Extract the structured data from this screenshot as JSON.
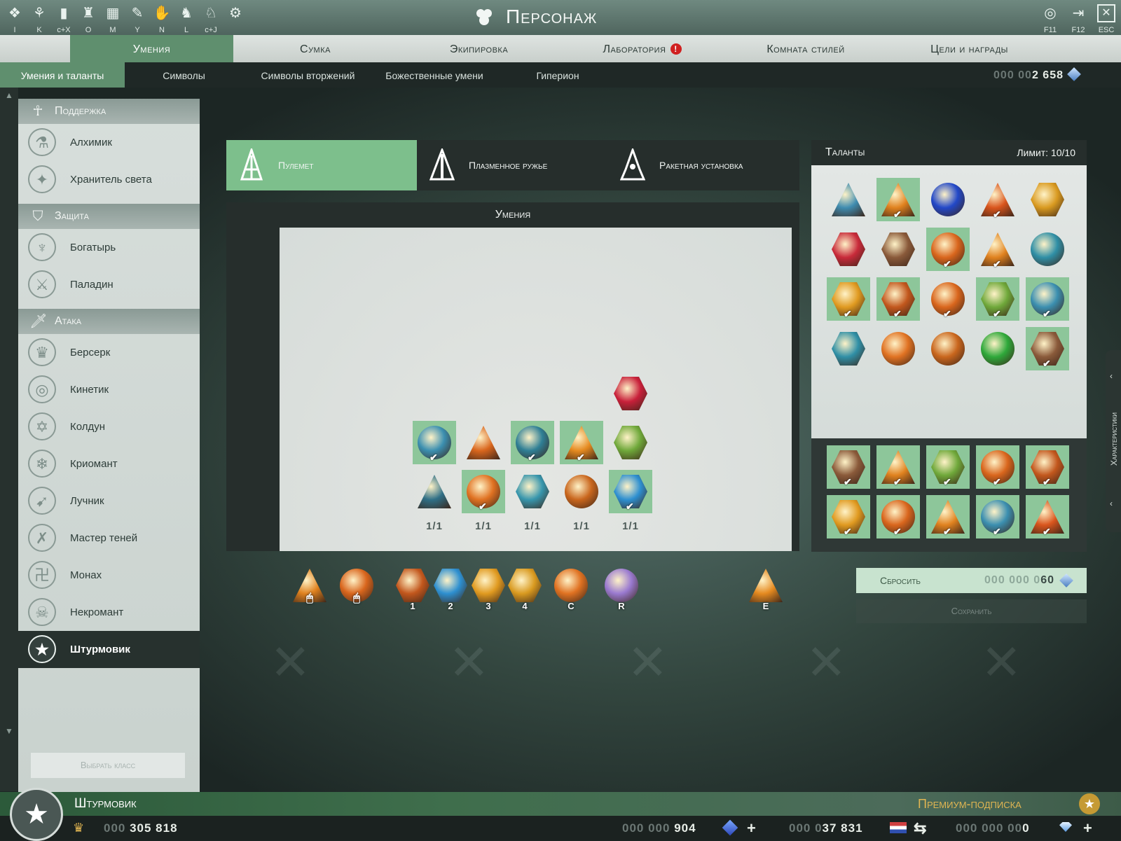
{
  "window": {
    "title": "Персонаж",
    "hotkeys_left": [
      "I",
      "K",
      "c+X",
      "O",
      "M",
      "Y",
      "N",
      "L",
      "c+J"
    ],
    "icons_left": [
      "character-icon",
      "skills-icon",
      "stats-icon",
      "guild-icon",
      "map-icon",
      "chat-icon",
      "friends-icon",
      "league-icon",
      "mount-icon",
      "settings-icon"
    ],
    "hotkeys_right": [
      "F11",
      "F12",
      "ESC"
    ]
  },
  "main_tabs": [
    {
      "label": "Умения",
      "active": true
    },
    {
      "label": "Сумка",
      "active": false
    },
    {
      "label": "Экипировка",
      "active": false
    },
    {
      "label": "Лаборатория",
      "active": false,
      "alert": "!"
    },
    {
      "label": "Комната стилей",
      "active": false
    },
    {
      "label": "Цели и награды",
      "active": false
    }
  ],
  "sub_tabs": [
    {
      "label": "Умения и таланты",
      "active": true
    },
    {
      "label": "Символы",
      "active": false
    },
    {
      "label": "Символы вторжений",
      "active": false
    },
    {
      "label": "Божественные умени",
      "active": false
    },
    {
      "label": "Гиперион",
      "active": false
    }
  ],
  "crystals": {
    "dim": "000 00",
    "value": "2 658"
  },
  "sidebar": {
    "categories": [
      {
        "label": "Поддержка",
        "icon": "ankh-icon",
        "classes": [
          {
            "label": "Алхимик",
            "icon": "flask-icon"
          },
          {
            "label": "Хранитель света",
            "icon": "wings-icon"
          }
        ]
      },
      {
        "label": "Защита",
        "icon": "shield-icon",
        "classes": [
          {
            "label": "Богатырь",
            "icon": "eagle-icon"
          },
          {
            "label": "Паладин",
            "icon": "sword-icon"
          }
        ]
      },
      {
        "label": "Атака",
        "icon": "dagger-icon",
        "classes": [
          {
            "label": "Берсерк",
            "icon": "helmet-icon"
          },
          {
            "label": "Кинетик",
            "icon": "spiral-icon"
          },
          {
            "label": "Колдун",
            "icon": "pentagram-icon"
          },
          {
            "label": "Криомант",
            "icon": "snowflake-icon"
          },
          {
            "label": "Лучник",
            "icon": "bow-icon"
          },
          {
            "label": "Мастер теней",
            "icon": "blades-icon"
          },
          {
            "label": "Монах",
            "icon": "glyph-icon"
          },
          {
            "label": "Некромант",
            "icon": "skull-icon"
          },
          {
            "label": "Штурмовик",
            "icon": "star-icon",
            "active": true
          }
        ]
      }
    ],
    "choose_class": "Выбрать класс"
  },
  "weapons": [
    {
      "label": "Пулемет",
      "active": true
    },
    {
      "label": "Плазменное ружье",
      "active": false
    },
    {
      "label": "Ракетная установка",
      "active": false
    }
  ],
  "skills": {
    "title": "Умения",
    "top": [
      {
        "color": "#c8203a",
        "shape": "hex"
      }
    ],
    "row1": [
      {
        "color": "#3b8fb0",
        "shape": "circle",
        "selected": true,
        "checked": true
      },
      {
        "color": "#d9661d",
        "shape": "tri",
        "selected": false,
        "checked": false
      },
      {
        "color": "#2f7f95",
        "shape": "circle",
        "selected": true,
        "checked": true
      },
      {
        "color": "#e58a20",
        "shape": "tri",
        "selected": true,
        "checked": true
      },
      {
        "color": "#6fa83a",
        "shape": "hex",
        "selected": false,
        "checked": false
      }
    ],
    "row2": [
      {
        "color": "#2f6f86",
        "shape": "tri",
        "selected": false,
        "checked": false
      },
      {
        "color": "#e07222",
        "shape": "circle",
        "selected": true,
        "checked": true
      },
      {
        "color": "#3796ad",
        "shape": "hex",
        "selected": false,
        "checked": false
      },
      {
        "color": "#c9661d",
        "shape": "circle",
        "selected": false,
        "checked": false
      },
      {
        "color": "#2d8fd0",
        "shape": "hex",
        "selected": true,
        "checked": true
      }
    ],
    "levels": [
      "1/1",
      "1/1",
      "1/1",
      "1/1",
      "1/1"
    ]
  },
  "talents": {
    "title": "Таланты",
    "limit": "Лимит: 10/10",
    "grid": [
      {
        "color": "#3f8cb0",
        "shape": "tri",
        "selected": false,
        "checked": false
      },
      {
        "color": "#e0821f",
        "shape": "tri",
        "selected": true,
        "checked": true
      },
      {
        "color": "#2248c8",
        "shape": "circle",
        "selected": false,
        "checked": false
      },
      {
        "color": "#d9551d",
        "shape": "tri",
        "selected": false,
        "checked": true
      },
      {
        "color": "#d99a20",
        "shape": "hex",
        "selected": false,
        "checked": false
      },
      {
        "color": "#c82a3a",
        "shape": "hex",
        "selected": false,
        "checked": false
      },
      {
        "color": "#8a5a3a",
        "shape": "hex",
        "selected": false,
        "checked": false
      },
      {
        "color": "#d9661d",
        "shape": "circle",
        "selected": true,
        "checked": true
      },
      {
        "color": "#e0821f",
        "shape": "tri",
        "selected": false,
        "checked": true
      },
      {
        "color": "#2f8fa6",
        "shape": "circle",
        "selected": false,
        "checked": false
      },
      {
        "color": "#e09a20",
        "shape": "hex",
        "selected": true,
        "checked": true
      },
      {
        "color": "#c2571d",
        "shape": "hex",
        "selected": true,
        "checked": true
      },
      {
        "color": "#d9661d",
        "shape": "circle",
        "selected": false,
        "checked": true
      },
      {
        "color": "#6fa83a",
        "shape": "hex",
        "selected": true,
        "checked": true
      },
      {
        "color": "#3b8fb0",
        "shape": "circle",
        "selected": true,
        "checked": true
      },
      {
        "color": "#2f8fa6",
        "shape": "hex",
        "selected": false,
        "checked": false
      },
      {
        "color": "#e07222",
        "shape": "circle",
        "selected": false,
        "checked": false
      },
      {
        "color": "#c9661d",
        "shape": "circle",
        "selected": false,
        "checked": false
      },
      {
        "color": "#2ea83a",
        "shape": "circle",
        "selected": false,
        "checked": false
      },
      {
        "color": "#8a5a3a",
        "shape": "hex",
        "selected": true,
        "checked": true
      }
    ],
    "selected": [
      {
        "color": "#8a5a3a",
        "shape": "hex"
      },
      {
        "color": "#e0821f",
        "shape": "tri"
      },
      {
        "color": "#6fa83a",
        "shape": "hex"
      },
      {
        "color": "#d9661d",
        "shape": "circle"
      },
      {
        "color": "#c2571d",
        "shape": "hex"
      },
      {
        "color": "#e09a20",
        "shape": "hex"
      },
      {
        "color": "#d9661d",
        "shape": "circle"
      },
      {
        "color": "#e0821f",
        "shape": "tri"
      },
      {
        "color": "#3b8fb0",
        "shape": "circle"
      },
      {
        "color": "#d9551d",
        "shape": "tri"
      }
    ]
  },
  "skill_bar": [
    {
      "key": "",
      "color": "#e0821f",
      "shape": "tri"
    },
    {
      "key": "",
      "color": "#d9661d",
      "shape": "circle"
    },
    {
      "key": "1",
      "color": "#c2571d",
      "shape": "hex"
    },
    {
      "key": "2",
      "color": "#2d8fd0",
      "shape": "hex"
    },
    {
      "key": "3",
      "color": "#e09a20",
      "shape": "hex"
    },
    {
      "key": "4",
      "color": "#d99a20",
      "shape": "hex"
    },
    {
      "key": "C",
      "color": "#e07222",
      "shape": "circle"
    },
    {
      "key": "R",
      "color": "#9a7ad0",
      "shape": "circle"
    },
    {
      "key": "E",
      "color": "#e58a20",
      "shape": "tri"
    }
  ],
  "reset": {
    "label": "Сбросить",
    "dim": "000 000 0",
    "value": "60"
  },
  "save": {
    "label": "Сохранить"
  },
  "side_panel": {
    "label": "Характеристики"
  },
  "footer": {
    "character": "Штурмовик",
    "premium": "Премиум-подписка",
    "gold": {
      "dim": "000 ",
      "value": "305 818"
    },
    "currency1": {
      "dim": "000 000 ",
      "value": "904"
    },
    "currency2": {
      "dim": "000 0",
      "value": "37 831"
    },
    "currency3": {
      "dim": "000 000 00",
      "value": "0"
    }
  }
}
